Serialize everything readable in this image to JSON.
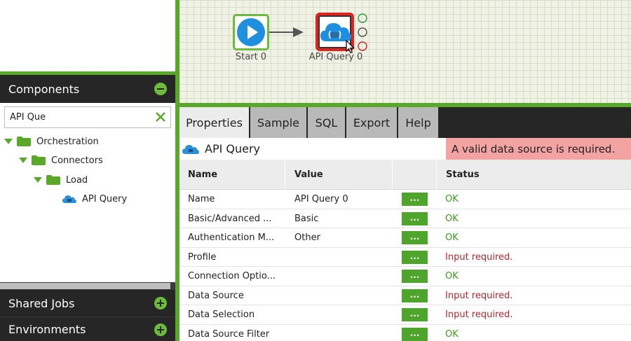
{
  "canvas": {
    "nodes": [
      {
        "label": "Start 0",
        "icon": "play-icon",
        "border_color": "#6dbb3c"
      },
      {
        "label": "API Query 0",
        "icon": "cloud-api-icon",
        "border_color": "#e0231c"
      }
    ]
  },
  "components": {
    "header": "Components",
    "search": {
      "value": "API Que",
      "placeholder": ""
    },
    "tree": [
      {
        "label": "Orchestration",
        "type": "folder",
        "depth": 0
      },
      {
        "label": "Connectors",
        "type": "folder",
        "depth": 1
      },
      {
        "label": "Load",
        "type": "folder",
        "depth": 2
      },
      {
        "label": "API Query",
        "type": "component",
        "depth": 3
      }
    ]
  },
  "shared_jobs": {
    "header": "Shared Jobs"
  },
  "environments": {
    "header": "Environments"
  },
  "properties": {
    "tabs": [
      {
        "label": "Properties",
        "active": true
      },
      {
        "label": "Sample",
        "active": false
      },
      {
        "label": "SQL",
        "active": false
      },
      {
        "label": "Export",
        "active": false
      },
      {
        "label": "Help",
        "active": false
      }
    ],
    "title": "API Query",
    "error": "A valid data source is required.",
    "columns": {
      "name": "Name",
      "value": "Value",
      "status": "Status"
    },
    "button_label": "...",
    "rows": [
      {
        "name": "Name",
        "value": "API Query 0",
        "status": "OK"
      },
      {
        "name": "Basic/Advanced ...",
        "value": "Basic",
        "status": "OK"
      },
      {
        "name": "Authentication M...",
        "value": "Other",
        "status": "OK"
      },
      {
        "name": "Profile",
        "value": "",
        "status": "Input required."
      },
      {
        "name": "Connection Optio...",
        "value": "",
        "status": "OK"
      },
      {
        "name": "Data Source",
        "value": "",
        "status": "Input required."
      },
      {
        "name": "Data Selection",
        "value": "",
        "status": "Input required."
      },
      {
        "name": "Data Source Filter",
        "value": "",
        "status": "OK"
      }
    ]
  },
  "colors": {
    "accent_green": "#5aa82a",
    "dark_panel": "#262626",
    "error_bg": "#f4a3a3",
    "status_ok": "#3b9a1e",
    "status_required": "#b3262e"
  }
}
